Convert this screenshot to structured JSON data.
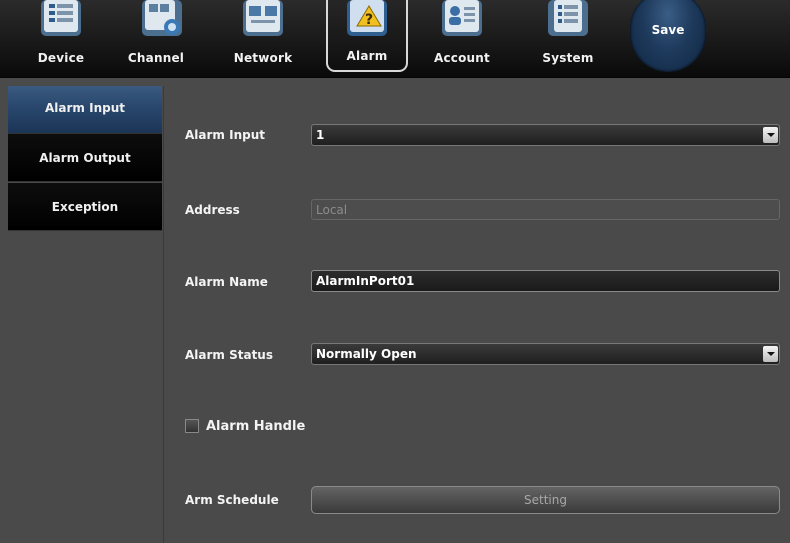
{
  "tabs": [
    {
      "label": "Device",
      "icon": "device-icon"
    },
    {
      "label": "Channel",
      "icon": "channel-icon"
    },
    {
      "label": "Network",
      "icon": "network-icon"
    },
    {
      "label": "Alarm",
      "icon": "alarm-icon",
      "active": true
    },
    {
      "label": "Account",
      "icon": "account-icon"
    },
    {
      "label": "System",
      "icon": "system-icon"
    }
  ],
  "save_label": "Save",
  "sidebar": {
    "items": [
      {
        "label": "Alarm Input",
        "active": true
      },
      {
        "label": "Alarm Output"
      },
      {
        "label": "Exception"
      }
    ]
  },
  "form": {
    "alarm_input": {
      "label": "Alarm Input",
      "value": "1"
    },
    "address": {
      "label": "Address",
      "value": "Local"
    },
    "alarm_name": {
      "label": "Alarm Name",
      "value": "AlarmInPort01"
    },
    "alarm_status": {
      "label": "Alarm Status",
      "value": "Normally Open"
    },
    "alarm_handle": {
      "label": "Alarm Handle",
      "checked": false
    },
    "arm_schedule": {
      "label": "Arm Schedule",
      "button": "Setting"
    }
  },
  "colors": {
    "accent": "#27456b",
    "panel": "#4a4a4a",
    "bar": "#141414"
  }
}
